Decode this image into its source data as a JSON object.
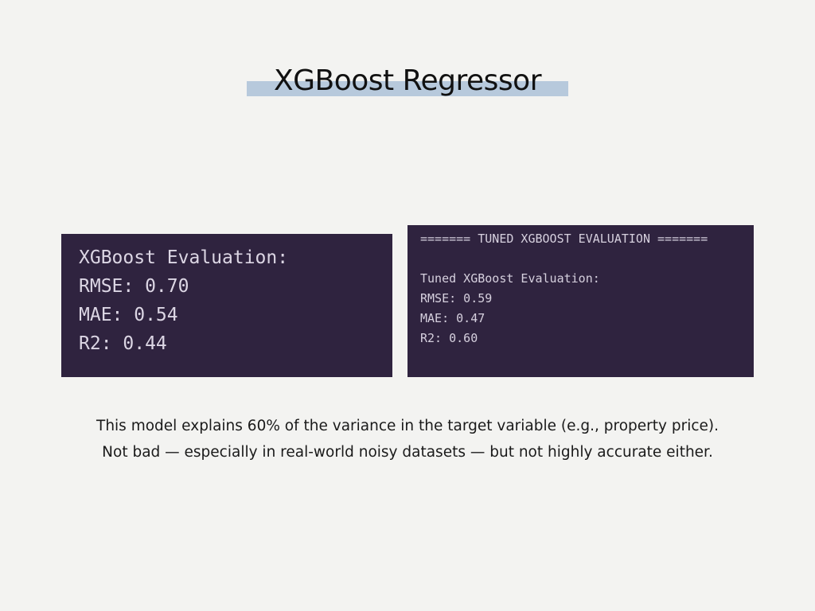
{
  "slide": {
    "title": "XGBoost Regressor"
  },
  "left_panel": {
    "lines": [
      "XGBoost Evaluation:",
      "RMSE: 0.70",
      "MAE: 0.54",
      "R2: 0.44"
    ]
  },
  "right_panel": {
    "lines": [
      "======= TUNED XGBOOST EVALUATION =======",
      "",
      "Tuned XGBoost Evaluation:",
      "RMSE: 0.59",
      "MAE: 0.47",
      "R2: 0.60"
    ]
  },
  "caption": {
    "line1": "This model explains 60% of the variance in the target variable (e.g., property price).",
    "line2": "Not bad — especially in real-world noisy datasets — but not highly accurate either."
  },
  "colors": {
    "background": "#f3f3f1",
    "panel": "#2f233f",
    "title_highlight": "#b7c9dc"
  }
}
